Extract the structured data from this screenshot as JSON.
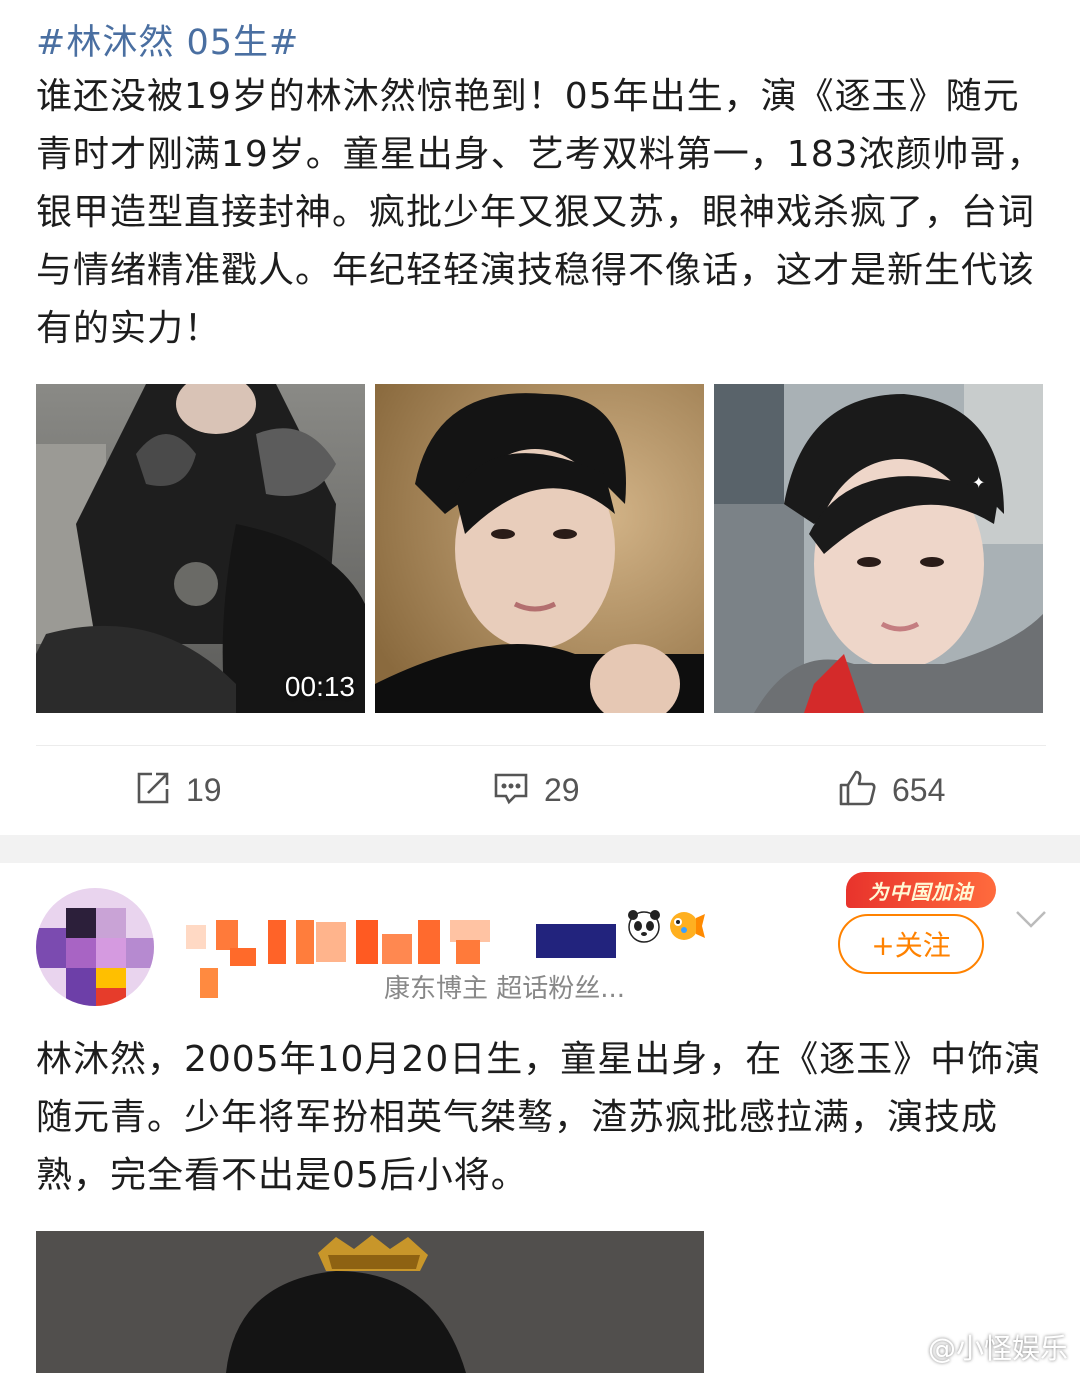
{
  "post1": {
    "hashtag": "#林沐然 05生#",
    "text": "谁还没被19岁的林沐然惊艳到！05年出生，演《逐玉》随元青时才刚满19岁。童星出身、艺考双料第一，183浓颜帅哥，银甲造型直接封神。疯批少年又狠又苏，眼神戏杀疯了，台词与情绪精准戳人。年纪轻轻演技稳得不像话，这才是新生代该有的实力！",
    "images": [
      {
        "name": "armor-horse-video",
        "duration": "00:13"
      },
      {
        "name": "portrait-dark"
      },
      {
        "name": "selfie-street"
      }
    ],
    "actions": {
      "repost_count": "19",
      "comment_count": "29",
      "like_count": "654"
    }
  },
  "post2": {
    "user_subtitle": "康东博主 超话粉丝...",
    "badge": "为中国加油",
    "follow_label": "+关注",
    "text": "林沐然，2005年10月20日生，童星出身，在《逐玉》中饰演随元青。少年将军扮相英气桀骜，渣苏疯批感拉满，演技成熟，完全看不出是05后小将。"
  },
  "watermark": "@小怪娱乐",
  "colors": {
    "hashtag": "#4a6fa1",
    "follow": "#ff8200",
    "badge": "#e8332c",
    "divider": "#f2f2f2"
  }
}
